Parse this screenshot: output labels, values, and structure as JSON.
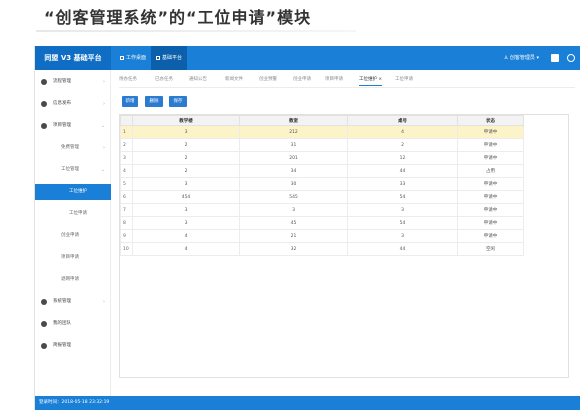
{
  "caption": "“创客管理系统”的“工位申请”模块",
  "header": {
    "brand": "同盟 V3 基础平台",
    "tabs": [
      "工作桌面",
      "基础平台"
    ],
    "user": "创客管理员 ▾"
  },
  "sidebar": {
    "items": [
      {
        "label": "流程管理",
        "level": 0,
        "arrow": "›"
      },
      {
        "label": "信息发布",
        "level": 0,
        "arrow": "›"
      },
      {
        "label": "项目管理",
        "level": 0,
        "arrow": "⌄"
      },
      {
        "label": "免费管理",
        "level": 1,
        "arrow": "›"
      },
      {
        "label": "工位管理",
        "level": 1,
        "arrow": "⌄"
      },
      {
        "label": "工位维护",
        "level": 2,
        "arrow": "",
        "active": true
      },
      {
        "label": "工位申请",
        "level": 2,
        "arrow": ""
      },
      {
        "label": "创业申请",
        "level": 1,
        "arrow": ""
      },
      {
        "label": "项目申请",
        "level": 1,
        "arrow": ""
      },
      {
        "label": "退网申请",
        "level": 1,
        "arrow": ""
      },
      {
        "label": "系统管理",
        "level": 0,
        "arrow": "›"
      },
      {
        "label": "我的团队",
        "level": 0,
        "arrow": ""
      },
      {
        "label": "简报管理",
        "level": 0,
        "arrow": ""
      }
    ]
  },
  "tabs": [
    "待办任务",
    "已办任务",
    "通知公告",
    "新闻文件",
    "创业预警",
    "创业申请",
    "项目申请",
    "工位维护",
    "工位申请"
  ],
  "active_tab": "工位维护",
  "buttons": {
    "add": "新增",
    "delete": "删除",
    "save": "保存"
  },
  "table": {
    "headers": [
      "",
      "教学楼",
      "教室",
      "桌号",
      "状态"
    ],
    "rows": [
      [
        "1",
        "3",
        "212",
        "4",
        "申请中"
      ],
      [
        "2",
        "2",
        "31",
        "2",
        "申请中"
      ],
      [
        "3",
        "2",
        "201",
        "12",
        "申请中"
      ],
      [
        "4",
        "2",
        "34",
        "44",
        "占用"
      ],
      [
        "5",
        "3",
        "30",
        "33",
        "申请中"
      ],
      [
        "6",
        "454",
        "545",
        "54",
        "申请中"
      ],
      [
        "7",
        "3",
        "3",
        "3",
        "申请中"
      ],
      [
        "8",
        "3",
        "45",
        "54",
        "申请中"
      ],
      [
        "9",
        "4",
        "21",
        "3",
        "申请中"
      ],
      [
        "10",
        "4",
        "32",
        "44",
        "空闲"
      ]
    ]
  },
  "status": "登录时间：2018-05-18 23:32:19"
}
